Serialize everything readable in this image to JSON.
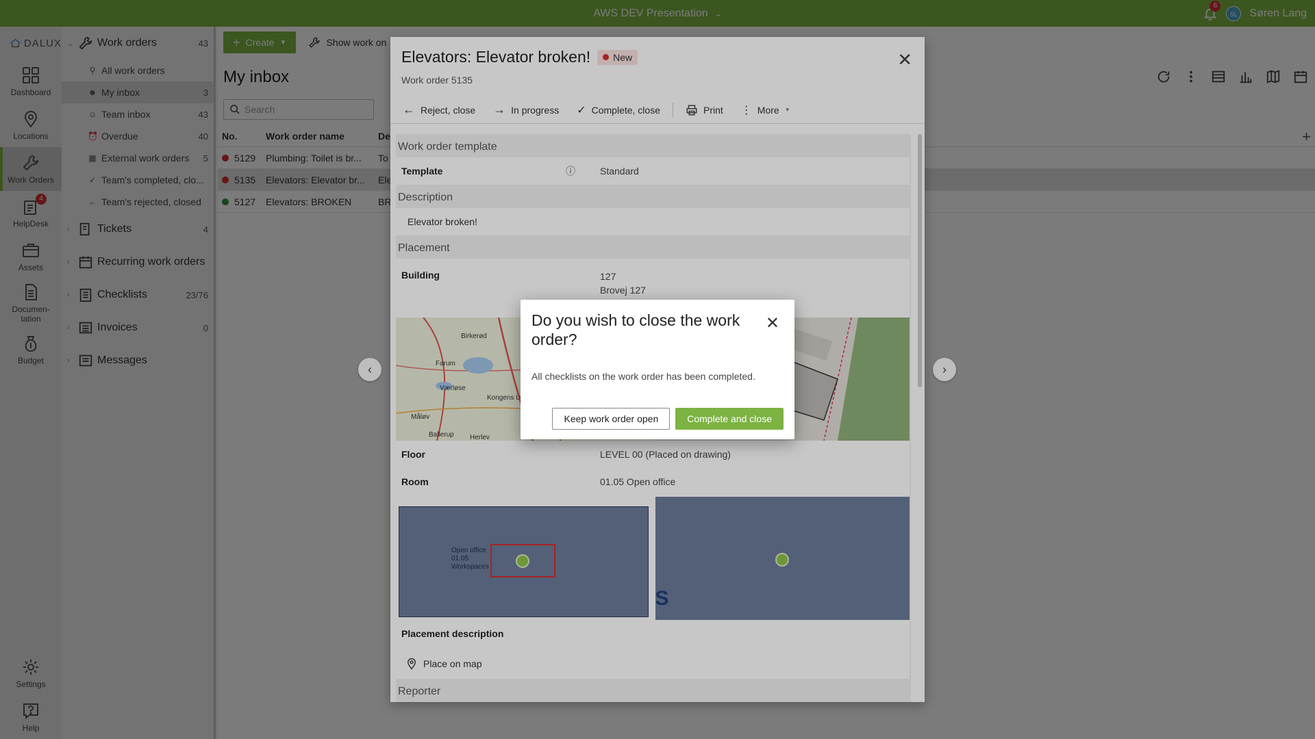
{
  "topbar": {
    "project": "AWS DEV Presentation",
    "notif_count": "6",
    "avatar_initials": "SL",
    "user": "Søren Lang"
  },
  "rail": {
    "logo": "DALUX",
    "items": [
      {
        "label": "Dashboard",
        "icon": "dashboard-icon"
      },
      {
        "label": "Locations",
        "icon": "location-pin-icon"
      },
      {
        "label": "Work Orders",
        "icon": "wrench-icon"
      },
      {
        "label": "HelpDesk",
        "icon": "helpdesk-icon",
        "badge": "4"
      },
      {
        "label": "Assets",
        "icon": "briefcase-icon"
      },
      {
        "label": "Documen-tation",
        "icon": "document-icon"
      },
      {
        "label": "Budget",
        "icon": "money-bag-icon"
      }
    ],
    "bottom": [
      {
        "label": "Settings"
      },
      {
        "label": "Help"
      }
    ]
  },
  "sidebar": {
    "work_orders": {
      "label": "Work orders",
      "count": "43"
    },
    "items": [
      {
        "label": "All work orders",
        "count": "",
        "icon": "search-icon"
      },
      {
        "label": "My inbox",
        "count": "3",
        "icon": "person-icon"
      },
      {
        "label": "Team inbox",
        "count": "43",
        "icon": "people-icon"
      },
      {
        "label": "Overdue",
        "count": "40",
        "icon": "alarm-icon"
      },
      {
        "label": "External work orders",
        "count": "5",
        "icon": "building-icon"
      },
      {
        "label": "Team's completed, clo...",
        "count": "",
        "icon": "check-icon"
      },
      {
        "label": "Team's rejected, closed",
        "count": "",
        "icon": "arrow-left-icon"
      }
    ],
    "groups": [
      {
        "label": "Tickets",
        "count": "4"
      },
      {
        "label": "Recurring work orders",
        "count": ""
      },
      {
        "label": "Checklists",
        "count": "23/76"
      },
      {
        "label": "Invoices",
        "count": "0"
      },
      {
        "label": "Messages",
        "count": ""
      }
    ]
  },
  "main": {
    "create_label": "Create",
    "show_work_label": "Show work on",
    "title": "My inbox",
    "search_placeholder": "Search",
    "columns": {
      "no": "No.",
      "name": "Work order name",
      "de": "De"
    },
    "rows": [
      {
        "no": "5129",
        "name": "Plumbing: Toilet is br...",
        "de": "To",
        "status_color": "#d32f2f"
      },
      {
        "no": "5135",
        "name": "Elevators: Elevator br...",
        "de": "Ele",
        "status_color": "#d32f2f"
      },
      {
        "no": "5127",
        "name": "Elevators: BROKEN",
        "de": "BR",
        "status_color": "#388e3c"
      }
    ]
  },
  "work_order": {
    "title": "Elevators: Elevator broken!",
    "status": "New",
    "subtitle": "Work order 5135",
    "actions": {
      "reject": "Reject, close",
      "progress": "In progress",
      "complete": "Complete, close",
      "print": "Print",
      "more": "More"
    },
    "template_section": "Work order template",
    "template_label": "Template",
    "template_value": "Standard",
    "description_section": "Description",
    "description_value": "Elevator broken!",
    "placement_section": "Placement",
    "building_label": "Building",
    "building_lines": [
      "127",
      "Brovej 127",
      "Dalux Copenhagen (Copenhagen)"
    ],
    "map_labels": [
      "Birkerød",
      "Farum",
      "Værløse",
      "Kongens Ly",
      "Måløv",
      "Ballerup",
      "Herlev"
    ],
    "floor_label": "Floor",
    "floor_value": "LEVEL 00 (Placed on drawing)",
    "room_label": "Room",
    "room_value": "01.05 Open office",
    "drawing_room_text": [
      "Open office",
      "01.05",
      "Workspaces"
    ],
    "drawing_letter": "S",
    "placement_desc_label": "Placement description",
    "place_on_map": "Place on map",
    "reporter_section": "Reporter"
  },
  "confirm": {
    "title": "Do you wish to close the work order?",
    "body": "All checklists on the work order has been completed.",
    "keep_label": "Keep work order open",
    "complete_label": "Complete and close"
  },
  "colors": {
    "brand": "#7cb342",
    "status_new": "#d32f2f",
    "status_done": "#388e3c"
  }
}
